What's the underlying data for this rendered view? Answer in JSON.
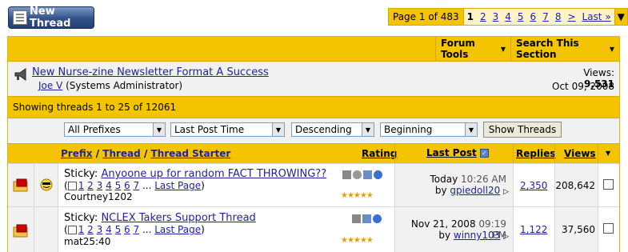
{
  "new_thread": {
    "label": "New Thread"
  },
  "pager": {
    "label": "Page 1 of 483",
    "pages": [
      "1",
      "2",
      "3",
      "4",
      "5",
      "6",
      "7",
      "8",
      ">",
      "Last »"
    ],
    "current": "1"
  },
  "toolbar": {
    "forum_tools": "Forum Tools",
    "search_section": "Search This Section"
  },
  "announcement": {
    "title": "New Nurse-zine Newsletter Format A Success",
    "author": "Joe V",
    "author_role": "(Systems Administrator)",
    "views_label": "Views:",
    "views": "9,531",
    "date": "Oct 09, 2008"
  },
  "showing": "Showing threads 1 to 25 of 12061",
  "filters": {
    "prefix": "All Prefixes",
    "sort": "Last Post Time",
    "order": "Descending",
    "from": "Beginning",
    "button": "Show Threads"
  },
  "columns": {
    "prefix": "Prefix",
    "sep1": "/",
    "thread": "Thread",
    "sep2": "/",
    "starter": "Thread Starter",
    "rating": "Rating",
    "last_post": "Last Post",
    "replies": "Replies",
    "views": "Views"
  },
  "threads": [
    {
      "prefix": "Sticky:",
      "title": "Anyoone up for random FACT THROWING??",
      "pages": [
        "1",
        "2",
        "3",
        "4",
        "5",
        "6",
        "7"
      ],
      "ellipsis": "...",
      "last_page": "Last Page",
      "paren_open": "(",
      "paren_close": ")",
      "starter": "Courtney1202",
      "last_date": "Today",
      "last_time": "10:26 AM",
      "by": "by",
      "last_user": "gpiedoll20",
      "replies": "2,350",
      "views": "208,642"
    },
    {
      "prefix": "Sticky:",
      "title": "NCLEX Takers Support Thread",
      "pages": [
        "1",
        "2",
        "3",
        "4",
        "5",
        "6",
        "7"
      ],
      "ellipsis": "...",
      "last_page": "Last Page",
      "paren_open": "(",
      "paren_close": ")",
      "starter": "mat25:40",
      "last_date": "Nov 21, 2008",
      "last_time": "09:19 PM",
      "by": "by",
      "last_user": "winny103",
      "replies": "1,122",
      "views": "37,560"
    }
  ],
  "colors": {
    "gold": "#f5c400",
    "link": "#22229c",
    "navy": "#33518a"
  }
}
